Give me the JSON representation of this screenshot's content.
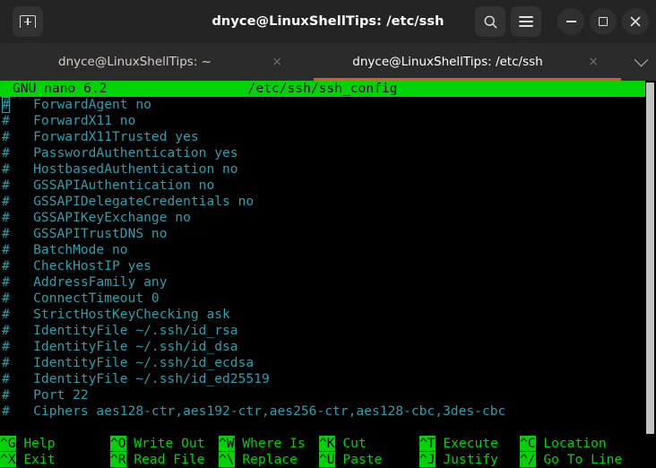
{
  "window": {
    "title": "dnyce@LinuxShellTips: /etc/ssh",
    "new_tab_icon": "new-tab-icon",
    "search_icon": "search-icon",
    "menu_icon": "hamburger-menu-icon",
    "minimize_icon": "minimize-icon",
    "maximize_icon": "maximize-icon",
    "close_icon": "close-icon",
    "accent_color": "#e95420"
  },
  "tabs": [
    {
      "label": "dnyce@LinuxShellTips: ~",
      "close": "×",
      "active": false
    },
    {
      "label": "dnyce@LinuxShellTips: /etc/ssh",
      "close": "×",
      "active": true
    }
  ],
  "tab_list_arrow": "chevron-down-icon",
  "nano": {
    "version": "GNU nano 6.2",
    "filename": "/etc/ssh/ssh_config",
    "header_bg": "#00d407",
    "header_fg": "#000000",
    "text_color": "#2e9fae",
    "lines": [
      "#   ForwardAgent no",
      "#   ForwardX11 no",
      "#   ForwardX11Trusted yes",
      "#   PasswordAuthentication yes",
      "#   HostbasedAuthentication no",
      "#   GSSAPIAuthentication no",
      "#   GSSAPIDelegateCredentials no",
      "#   GSSAPIKeyExchange no",
      "#   GSSAPITrustDNS no",
      "#   BatchMode no",
      "#   CheckHostIP yes",
      "#   AddressFamily any",
      "#   ConnectTimeout 0",
      "#   StrictHostKeyChecking ask",
      "#   IdentityFile ~/.ssh/id_rsa",
      "#   IdentityFile ~/.ssh/id_dsa",
      "#   IdentityFile ~/.ssh/id_ecdsa",
      "#   IdentityFile ~/.ssh/id_ed25519",
      "#   Port 22",
      "#   Ciphers aes128-ctr,aes192-ctr,aes256-ctr,aes128-cbc,3des-cbc"
    ],
    "cursor_line": 0,
    "cursor_col": 0
  },
  "shortcuts": {
    "row1": [
      {
        "key": "^G",
        "label": "Help"
      },
      {
        "key": "^O",
        "label": "Write Out"
      },
      {
        "key": "^W",
        "label": "Where Is"
      },
      {
        "key": "^K",
        "label": "Cut"
      },
      {
        "key": "^T",
        "label": "Execute"
      },
      {
        "key": "^C",
        "label": "Location"
      }
    ],
    "row2": [
      {
        "key": "^X",
        "label": "Exit"
      },
      {
        "key": "^R",
        "label": "Read File"
      },
      {
        "key": "^\\",
        "label": "Replace"
      },
      {
        "key": "^U",
        "label": "Paste"
      },
      {
        "key": "^J",
        "label": "Justify"
      },
      {
        "key": "^/",
        "label": "Go To Line"
      }
    ]
  }
}
